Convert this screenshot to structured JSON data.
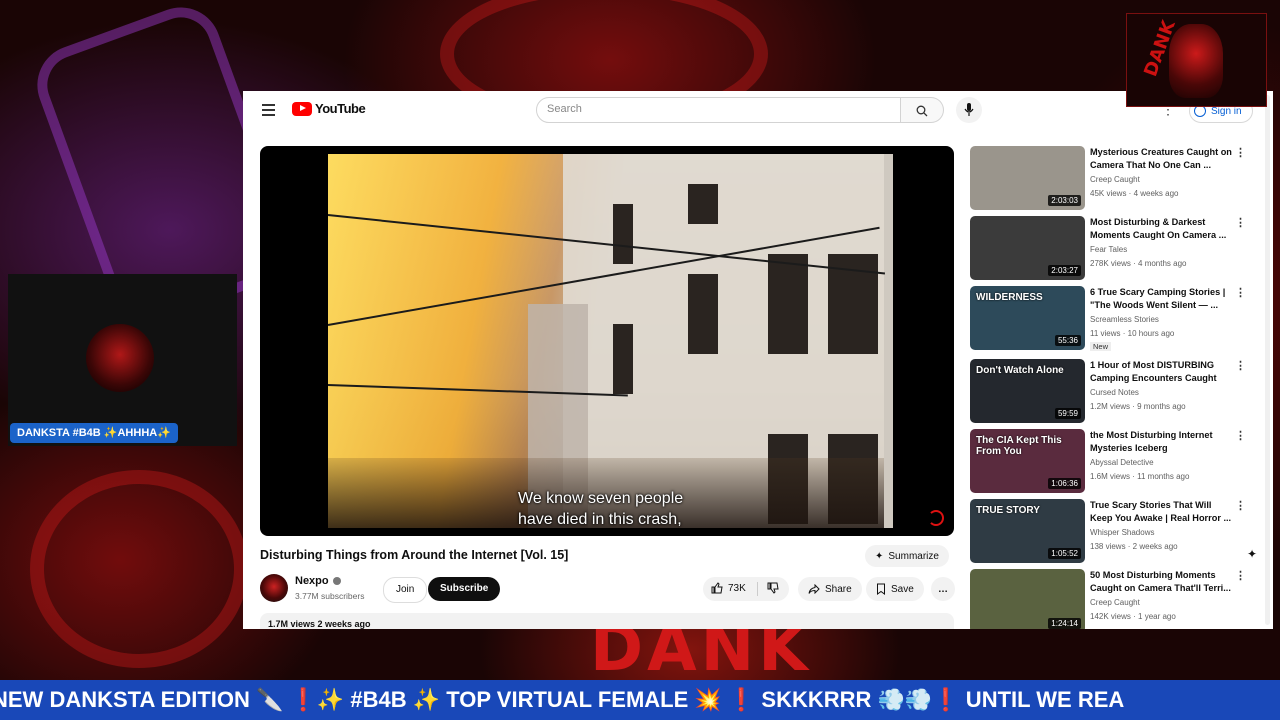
{
  "header": {
    "logo_text": "YouTube",
    "search_placeholder": "Search",
    "sign_in": "Sign in"
  },
  "video": {
    "subtitle_line1": "We know seven people",
    "subtitle_line2": "have died in this crash,",
    "title": "Disturbing Things from Around the Internet [Vol. 15]",
    "summarize": "Summarize",
    "channel": "Nexpo",
    "subscribers": "3.77M subscribers",
    "join": "Join",
    "subscribe": "Subscribe",
    "likes": "73K",
    "share": "Share",
    "save": "Save",
    "more": "…",
    "views_date": "1.7M views  2 weeks ago"
  },
  "sidebar": {
    "items": [
      {
        "title": "Mysterious Creatures Caught on Camera That No One Can ...",
        "channel": "Creep Caught",
        "meta": "45K views · 4 weeks ago",
        "duration": "2:03:03",
        "thumb_text": "",
        "thumb_color": "#9a958c"
      },
      {
        "title": "Most Disturbing & Darkest Moments Caught On Camera ...",
        "channel": "Fear Tales",
        "meta": "278K views · 4 months ago",
        "duration": "2:03:27",
        "thumb_text": "",
        "thumb_color": "#3b3b3b"
      },
      {
        "title": "6 True Scary Camping Stories | \"The Woods Went Silent — ...",
        "channel": "Screamless Stories",
        "meta": "11 views · 10 hours ago",
        "duration": "55:36",
        "thumb_text": "WILDERNESS",
        "thumb_color": "#2d4a5a",
        "badge": "New"
      },
      {
        "title": "1 Hour of Most DISTURBING Camping Encounters Caught o...",
        "channel": "Cursed Notes",
        "meta": "1.2M views · 9 months ago",
        "duration": "59:59",
        "thumb_text": "Don't Watch Alone",
        "thumb_color": "#24282e"
      },
      {
        "title": "the Most Disturbing Internet Mysteries Iceberg",
        "channel": "Abyssal Detective",
        "meta": "1.6M views · 11 months ago",
        "duration": "1:06:36",
        "thumb_text": "The CIA Kept This From You",
        "thumb_color": "#5a2b3e"
      },
      {
        "title": "True Scary Stories That Will Keep You Awake | Real Horror ...",
        "channel": "Whisper Shadows",
        "meta": "138 views · 2 weeks ago",
        "duration": "1:05:52",
        "thumb_text": "TRUE STORY",
        "thumb_color": "#2f3b44"
      },
      {
        "title": "50 Most Disturbing Moments Caught on Camera That'll Terri...",
        "channel": "Creep Caught",
        "meta": "142K views · 1 year ago",
        "duration": "1:24:14",
        "thumb_text": "",
        "thumb_color": "#5a6240"
      }
    ]
  },
  "overlay": {
    "cam_label": "DANKSTA #B4B ✨AHHHA✨",
    "logo_text": "DANK",
    "bg_text": "DANK",
    "ticker": "NEW DANKSTA EDITION 🔪 ❗✨ #B4B ✨ TOP VIRTUAL FEMALE 💥 ❗ SKKKRRR 💨💨❗ UNTIL WE REA"
  },
  "colors": {
    "youtube_red": "#ff0000",
    "ticker_bg": "#1948b8",
    "cam_label_bg": "#1b63c9"
  }
}
